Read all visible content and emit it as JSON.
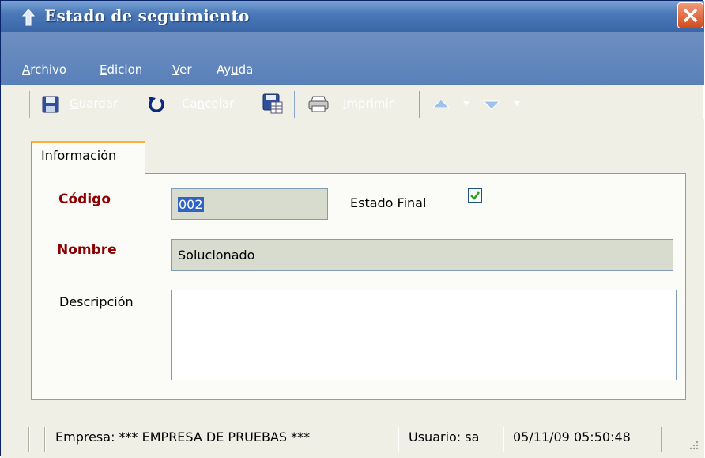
{
  "window": {
    "title": "Estado de seguimiento"
  },
  "menu": {
    "archivo": "Archivo",
    "edicion": "Edicion",
    "ver": "Ver",
    "ayuda": "Ayuda"
  },
  "toolbar": {
    "guardar": "Guardar",
    "cancelar": "Cancelar",
    "imprimir": "Imprimir"
  },
  "tabs": [
    {
      "label": "Información"
    }
  ],
  "form": {
    "codigo_label": "Código",
    "codigo_value": "002",
    "estado_final_label": "Estado Final",
    "estado_final_checked": true,
    "nombre_label": "Nombre",
    "nombre_value": "Solucionado",
    "descripcion_label": "Descripción",
    "descripcion_value": ""
  },
  "status": {
    "empresa": "Empresa: *** EMPRESA DE PRUEBAS ***",
    "usuario": "Usuario: sa",
    "fecha": "05/11/09 05:50:48"
  },
  "colors": {
    "title_bar": "#4a78b8",
    "menu_bar": "#5a80ba",
    "required_label": "#8b0000",
    "tab_accent": "#f6b23d",
    "field_background": "#d7dccf"
  },
  "icons": {
    "app": "arrow-up-icon",
    "close": "close-icon",
    "save": "floppy-disk-icon",
    "cancel": "undo-icon",
    "save_as": "save-table-icon",
    "print": "printer-icon",
    "previous": "arrow-up-icon",
    "next": "arrow-down-icon"
  }
}
